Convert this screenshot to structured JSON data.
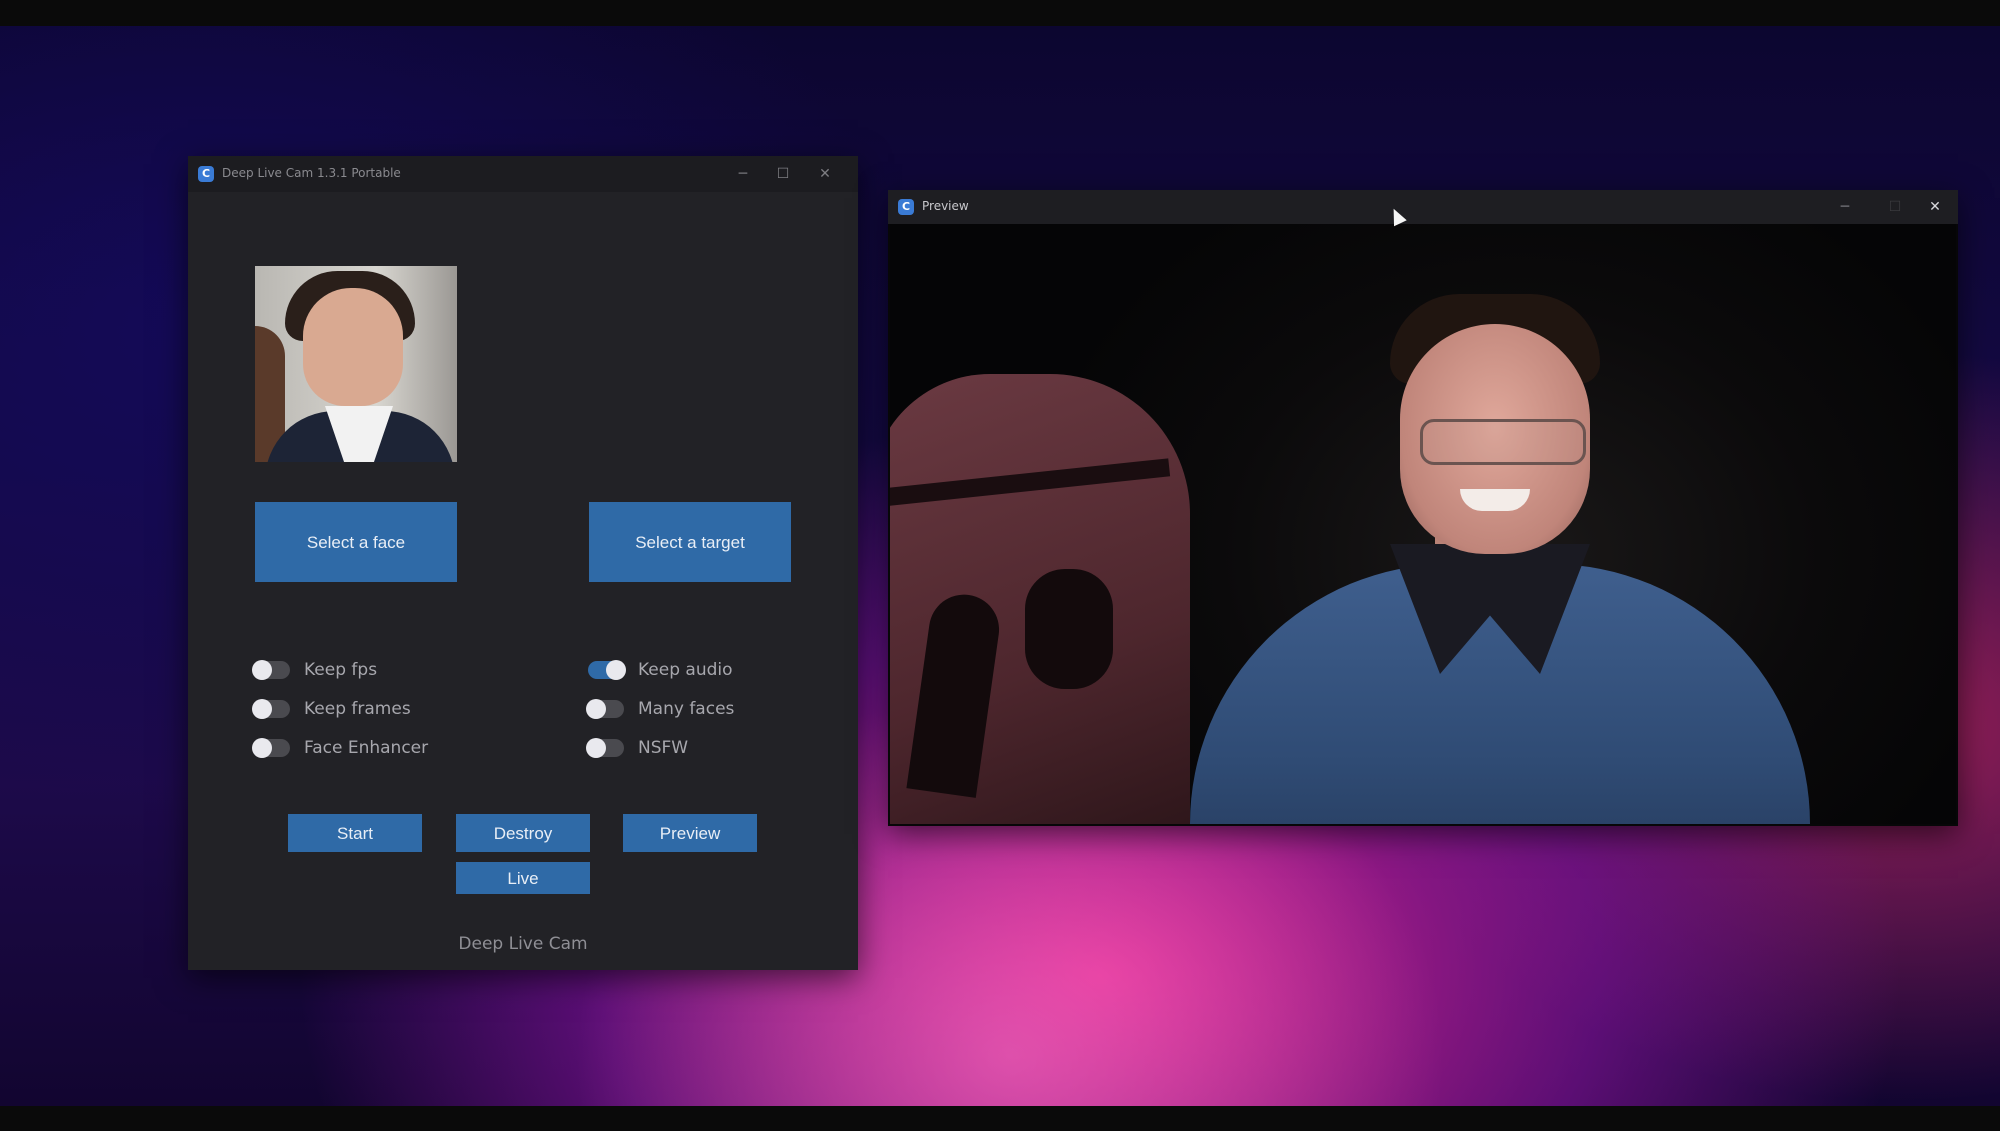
{
  "main_window": {
    "title": "Deep Live Cam 1.3.1 Portable",
    "controls": {
      "minimize": "─",
      "maximize": "☐",
      "close": "✕"
    },
    "select_face_label": "Select a face",
    "select_target_label": "Select a target",
    "toggles": [
      {
        "label": "Keep fps",
        "on": false
      },
      {
        "label": "Keep frames",
        "on": false
      },
      {
        "label": "Face Enhancer",
        "on": false
      },
      {
        "label": "Keep audio",
        "on": true
      },
      {
        "label": "Many faces",
        "on": false
      },
      {
        "label": "NSFW",
        "on": false
      }
    ],
    "start_label": "Start",
    "destroy_label": "Destroy",
    "preview_label": "Preview",
    "live_label": "Live",
    "footer": "Deep Live Cam"
  },
  "preview_window": {
    "title": "Preview",
    "controls": {
      "minimize": "─",
      "maximize": "☐",
      "close": "✕"
    }
  },
  "icons": {
    "app": "app-logo-icon",
    "cursor": "mouse-pointer-icon"
  },
  "colors": {
    "button_blue": "#2f6aa7",
    "window_bg": "#222226",
    "titlebar_bg": "#1c1c20"
  }
}
